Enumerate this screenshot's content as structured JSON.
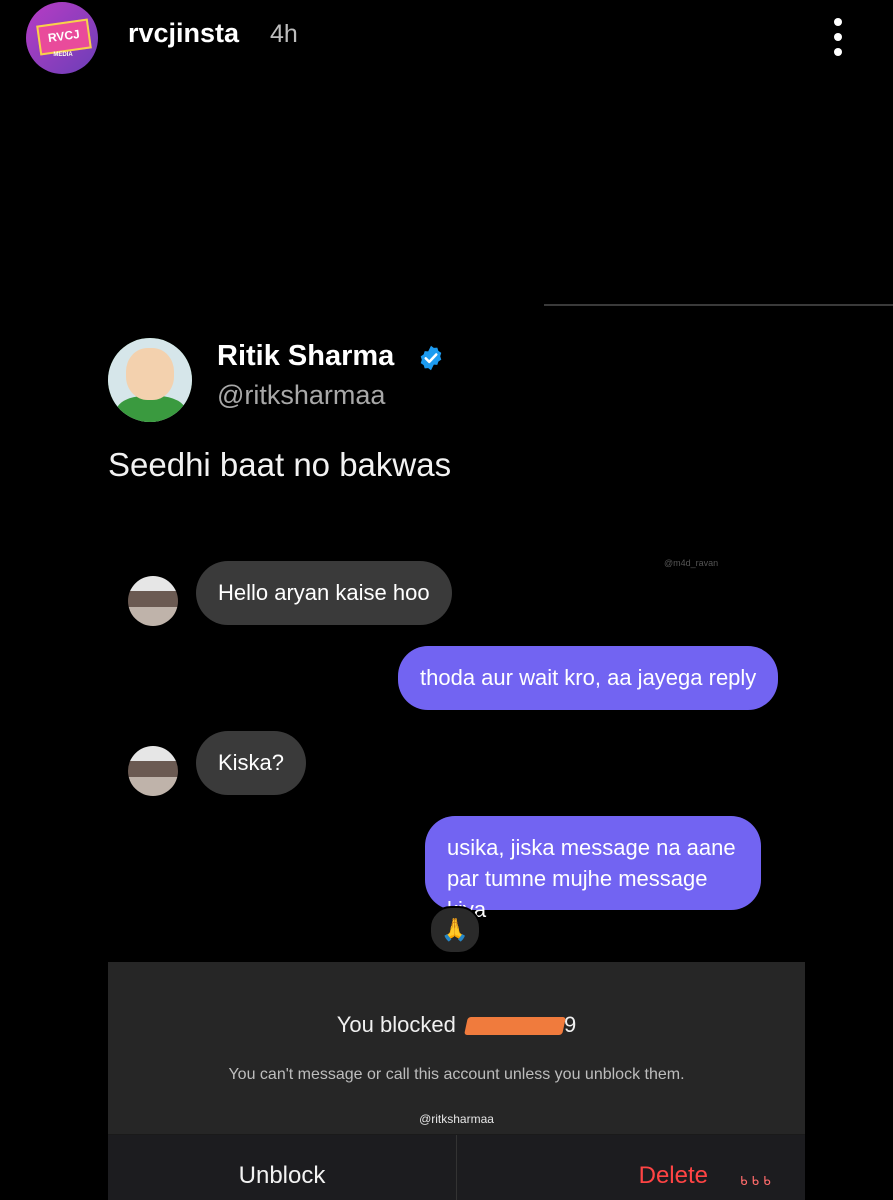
{
  "header": {
    "logo_text": "RVCJ",
    "logo_subtext": "MEDIA",
    "username": "rvcjinsta",
    "time_ago": "4h",
    "menu_icon": "more-vertical-icon"
  },
  "tweet": {
    "name": "Ritik Sharma",
    "handle": "@ritksharmaa",
    "verified_icon": "verified-badge-icon",
    "verified_color": "#1d9bf0",
    "text": "Seedhi baat no bakwas"
  },
  "chat": {
    "watermark": "@m4d_ravan",
    "messages": [
      {
        "from": "them",
        "text": "Hello aryan kaise hoo"
      },
      {
        "from": "me",
        "text": "thoda aur wait kro, aa jayega reply"
      },
      {
        "from": "them",
        "text": "Kiska?"
      },
      {
        "from": "me",
        "text_line1": "usika, jiska message na aane",
        "text_line2": "par tumne mujhe message kiya"
      }
    ],
    "reaction": "🙏",
    "outgoing_color": "#7264f2",
    "incoming_color": "#3a3a3a"
  },
  "blocked": {
    "title_prefix": "You blocked",
    "title_suffix": "9",
    "description": "You can't message or call this account unless you unblock them.",
    "handle": "@ritksharmaa",
    "unblock_label": "Unblock",
    "delete_label": "Delete",
    "delete_color": "#ff4444"
  }
}
